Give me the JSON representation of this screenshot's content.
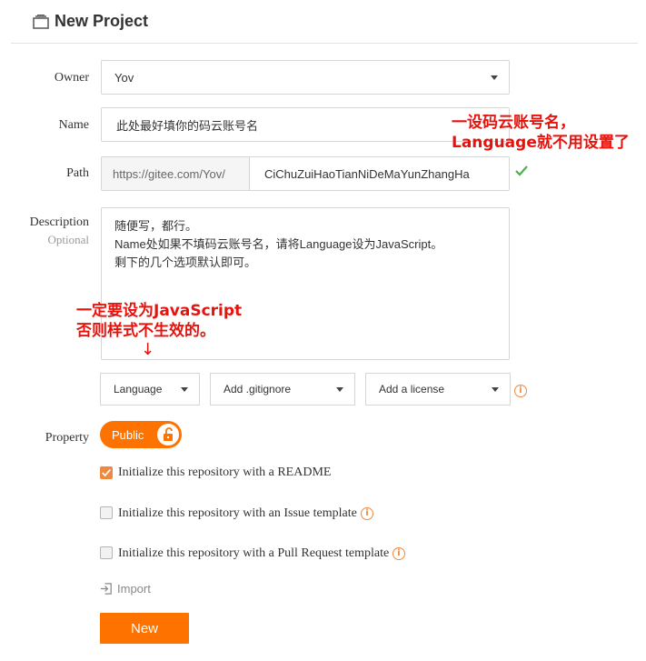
{
  "header": {
    "title": "New Project",
    "icon": "repo-icon"
  },
  "form": {
    "owner": {
      "label": "Owner",
      "value": "Yov"
    },
    "name": {
      "label": "Name",
      "value": "此处最好填你的码云账号名"
    },
    "path": {
      "label": "Path",
      "prefix": "https://gitee.com/Yov/",
      "value": "CiChuZuiHaoTianNiDeMaYunZhangHa"
    },
    "description": {
      "label": "Description",
      "sublabel": "Optional",
      "lines": [
        "随便写，都行。",
        "Name处如果不填码云账号名，请将Language设为JavaScript。",
        "剩下的几个选项默认即可。"
      ]
    },
    "language_dropdown": "Language",
    "gitignore_dropdown": "Add .gitignore",
    "license_dropdown": "Add a license",
    "property": {
      "label": "Property",
      "toggle_label": "Public",
      "state": "public"
    },
    "options": [
      {
        "label": "Initialize this repository with a README",
        "checked": true
      },
      {
        "label": "Initialize this repository with an Issue template",
        "checked": false
      },
      {
        "label": "Initialize this repository with a Pull Request template",
        "checked": false
      }
    ],
    "import_label": "Import",
    "submit_label": "New"
  },
  "annotations": {
    "name_note": [
      "一设码云账号名，",
      "Language就不用设置了"
    ],
    "language_note": [
      "一定要设为JavaScript",
      "否则样式不生效的。"
    ],
    "arrow": "↓",
    "color": "#e8120c"
  },
  "colors": {
    "accent": "#fe7300",
    "check_green": "#4caf50",
    "info_orange": "#f0883e"
  }
}
